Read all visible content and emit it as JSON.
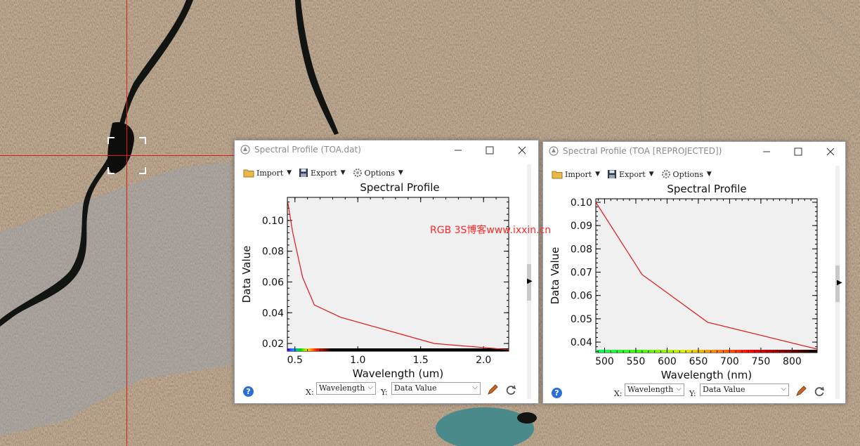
{
  "background": {
    "crosshair_color": "#e31818"
  },
  "windows": [
    {
      "title": "Spectral Profile (TOA.dat)",
      "toolbar": {
        "import": "Import",
        "export": "Export",
        "options": "Options"
      },
      "bottom": {
        "x_label": "X:",
        "x_value": "Wavelength",
        "y_label": "Y:",
        "y_value": "Data Value"
      }
    },
    {
      "title": "Spectral Profile (TOA [REPROJECTED])",
      "toolbar": {
        "import": "Import",
        "export": "Export",
        "options": "Options"
      },
      "bottom": {
        "x_label": "X:",
        "x_value": "Wavelength",
        "y_label": "Y:",
        "y_value": "Data Value"
      }
    }
  ],
  "chart_data": [
    {
      "type": "line",
      "title": "Spectral Profile",
      "xlabel": "Wavelength (um)",
      "ylabel": "Data Value",
      "xlim": [
        0.44,
        2.2
      ],
      "ylim": [
        0.015,
        0.115
      ],
      "xticks": [
        0.5,
        1.0,
        1.5,
        2.0
      ],
      "xtick_labels": [
        "0.5",
        "1.0",
        "1.5",
        "2.0"
      ],
      "yticks": [
        0.02,
        0.04,
        0.06,
        0.08,
        0.1
      ],
      "ytick_labels": [
        "0.02",
        "0.04",
        "0.06",
        "0.08",
        "0.10"
      ],
      "grid": false,
      "line_color": "#e31818",
      "series": [
        {
          "x": [
            0.443,
            0.483,
            0.561,
            0.655,
            0.865,
            1.609,
            2.201
          ],
          "y": [
            0.112,
            0.092,
            0.063,
            0.045,
            0.037,
            0.02,
            0.016
          ]
        }
      ]
    },
    {
      "type": "line",
      "title": "Spectral Profile",
      "xlabel": "Wavelength (nm)",
      "ylabel": "Data Value",
      "xlim": [
        486,
        840
      ],
      "ylim": [
        0.0355,
        0.1015
      ],
      "xticks": [
        500,
        550,
        600,
        650,
        700,
        750,
        800
      ],
      "xtick_labels": [
        "500",
        "550",
        "600",
        "650",
        "700",
        "750",
        "800"
      ],
      "yticks": [
        0.04,
        0.05,
        0.06,
        0.07,
        0.08,
        0.09,
        0.1
      ],
      "ytick_labels": [
        "0.04",
        "0.05",
        "0.06",
        "0.07",
        "0.08",
        "0.09",
        "0.10"
      ],
      "grid": false,
      "line_color": "#e31818",
      "series": [
        {
          "x": [
            486,
            560,
            665,
            840
          ],
          "y": [
            0.1,
            0.069,
            0.0485,
            0.037
          ]
        }
      ]
    }
  ],
  "watermark": "RGB 3S博客www.ixxin.cn"
}
